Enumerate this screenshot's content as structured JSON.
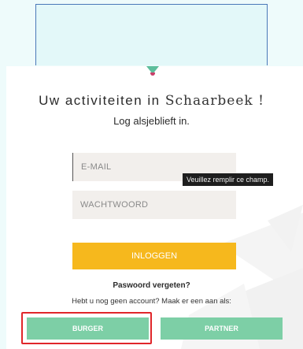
{
  "heading": {
    "prefix": "Uw activiteiten in",
    "place": "Schaarbeek !",
    "subtitle": "Log alsjeblieft in."
  },
  "form": {
    "email_placeholder": "E-MAIL",
    "password_placeholder": "WACHTWOORD",
    "validation_tooltip": "Veuillez remplir ce champ.",
    "login_label": "INLOGGEN",
    "forgot_label": "Paswoord vergeten?",
    "no_account_text": "Hebt u nog geen account? Maak er een aan als:"
  },
  "account_types": {
    "burger_label": "BURGER",
    "partner_label": "PARTNER"
  },
  "colors": {
    "accent_yellow": "#f6b81d",
    "accent_green": "#7dcfa6",
    "highlight_red": "#e0262a"
  }
}
